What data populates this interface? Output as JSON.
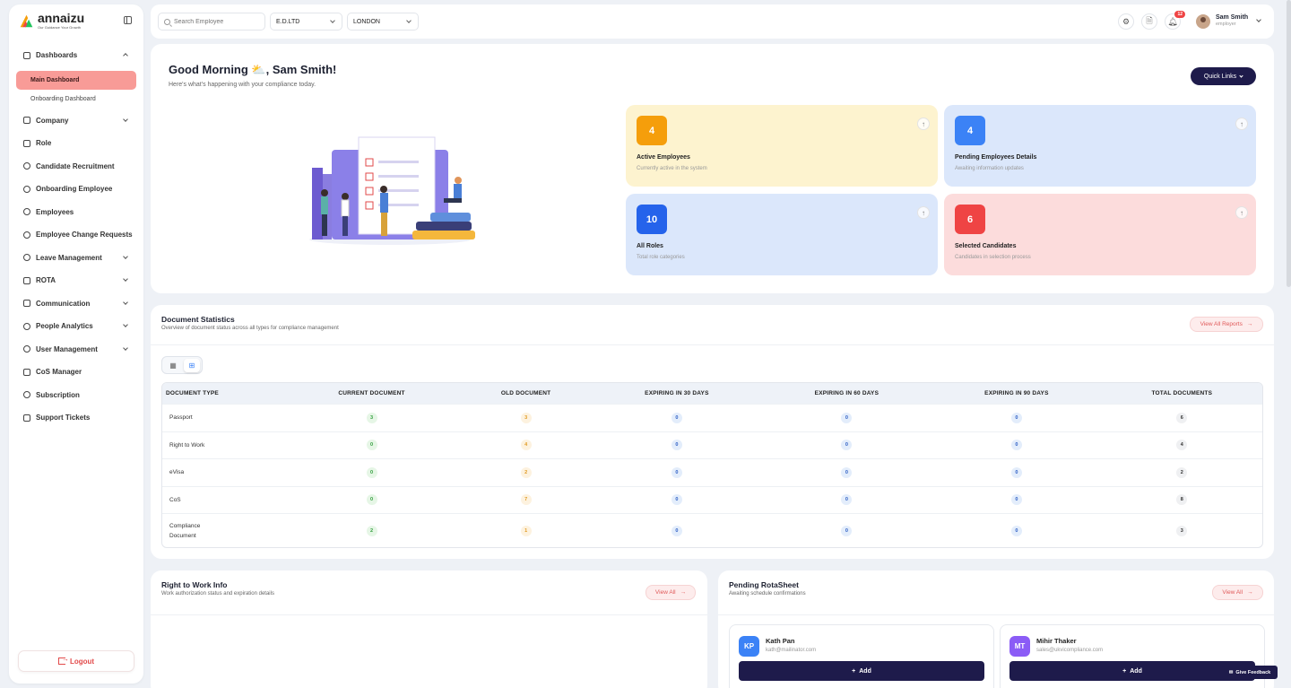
{
  "brand": {
    "name": "annaizu",
    "tagline": "Our Guidance Your Growth"
  },
  "sidebar": {
    "items": [
      {
        "label": "Dashboards",
        "icon": "grid-icon",
        "expandable": true,
        "expanded": true
      },
      {
        "label": "Company",
        "icon": "building-icon",
        "expandable": true
      },
      {
        "label": "Role",
        "icon": "briefcase-icon"
      },
      {
        "label": "Candidate Recruitment",
        "icon": "user-search-icon"
      },
      {
        "label": "Onboarding Employee",
        "icon": "user-plus-icon"
      },
      {
        "label": "Employees",
        "icon": "users-icon"
      },
      {
        "label": "Employee Change Requests",
        "icon": "user-edit-icon"
      },
      {
        "label": "Leave Management",
        "icon": "walking-icon",
        "expandable": true
      },
      {
        "label": "ROTA",
        "icon": "calendar-icon",
        "expandable": true
      },
      {
        "label": "Communication",
        "icon": "chat-icon",
        "expandable": true
      },
      {
        "label": "People Analytics",
        "icon": "people-chart-icon",
        "expandable": true
      },
      {
        "label": "User Management",
        "icon": "user-cog-icon",
        "expandable": true
      },
      {
        "label": "CoS Manager",
        "icon": "chart-icon"
      },
      {
        "label": "Subscription",
        "icon": "subscription-icon"
      },
      {
        "label": "Support Tickets",
        "icon": "ticket-icon"
      }
    ],
    "sub_items": [
      "Main Dashboard",
      "Onboarding Dashboard"
    ],
    "logout": "Logout"
  },
  "topbar": {
    "search_placeholder": "Search Employee",
    "company": "E.D.LTD",
    "location": "LONDON",
    "notification_count": "12",
    "user_name": "Sam Smith",
    "user_role": "employer"
  },
  "hero": {
    "greeting": "Good Morning ⛅, Sam Smith!",
    "subtitle": "Here's what's happening with your compliance today.",
    "quick_links": "Quick Links",
    "stats": [
      {
        "value": "4",
        "title": "Active Employees",
        "subtitle": "Currently active in the system",
        "color": "#f59e0b"
      },
      {
        "value": "4",
        "title": "Pending Employees Details",
        "subtitle": "Awaiting information updates",
        "color": "#3b82f6"
      },
      {
        "value": "10",
        "title": "All Roles",
        "subtitle": "Total role categories",
        "color": "#2563eb"
      },
      {
        "value": "6",
        "title": "Selected Candidates",
        "subtitle": "Candidates in selection process",
        "color": "#ef4444"
      }
    ]
  },
  "documents": {
    "title": "Document Statistics",
    "subtitle": "Overview of document status across all types for compliance management",
    "view_all": "View All Reports",
    "columns": [
      "DOCUMENT TYPE",
      "CURRENT DOCUMENT",
      "OLD DOCUMENT",
      "EXPIRING IN 30 DAYS",
      "EXPIRING IN 60 DAYS",
      "EXPIRING IN 90 DAYS",
      "TOTAL DOCUMENTS"
    ],
    "rows": [
      {
        "type": "Passport",
        "current": "3",
        "old": "3",
        "exp30": "0",
        "exp60": "0",
        "exp90": "0",
        "total": "6"
      },
      {
        "type": "Right to Work",
        "current": "0",
        "old": "4",
        "exp30": "0",
        "exp60": "0",
        "exp90": "0",
        "total": "4"
      },
      {
        "type": "eVisa",
        "current": "0",
        "old": "2",
        "exp30": "0",
        "exp60": "0",
        "exp90": "0",
        "total": "2"
      },
      {
        "type": "CoS",
        "current": "0",
        "old": "7",
        "exp30": "0",
        "exp60": "0",
        "exp90": "0",
        "total": "8"
      },
      {
        "type": "Compliance Document",
        "current": "2",
        "old": "1",
        "exp30": "0",
        "exp60": "0",
        "exp90": "0",
        "total": "3"
      }
    ]
  },
  "rtw": {
    "title": "Right to Work Info",
    "subtitle": "Work authorization status and expiration details",
    "view_all": "View All"
  },
  "rota": {
    "title": "Pending RotaSheet",
    "subtitle": "Awaiting schedule confirmations",
    "view_all": "View All",
    "cards": [
      {
        "initials": "KP",
        "name": "Kath Pan",
        "email": "kath@mailinator.com",
        "color": "#3b82f6",
        "add": "Add"
      },
      {
        "initials": "MT",
        "name": "Mihir Thaker",
        "email": "sales@ukvicompliance.com",
        "color": "#8b5cf6",
        "add": "Add"
      }
    ]
  },
  "feedback": "Give Feedback"
}
